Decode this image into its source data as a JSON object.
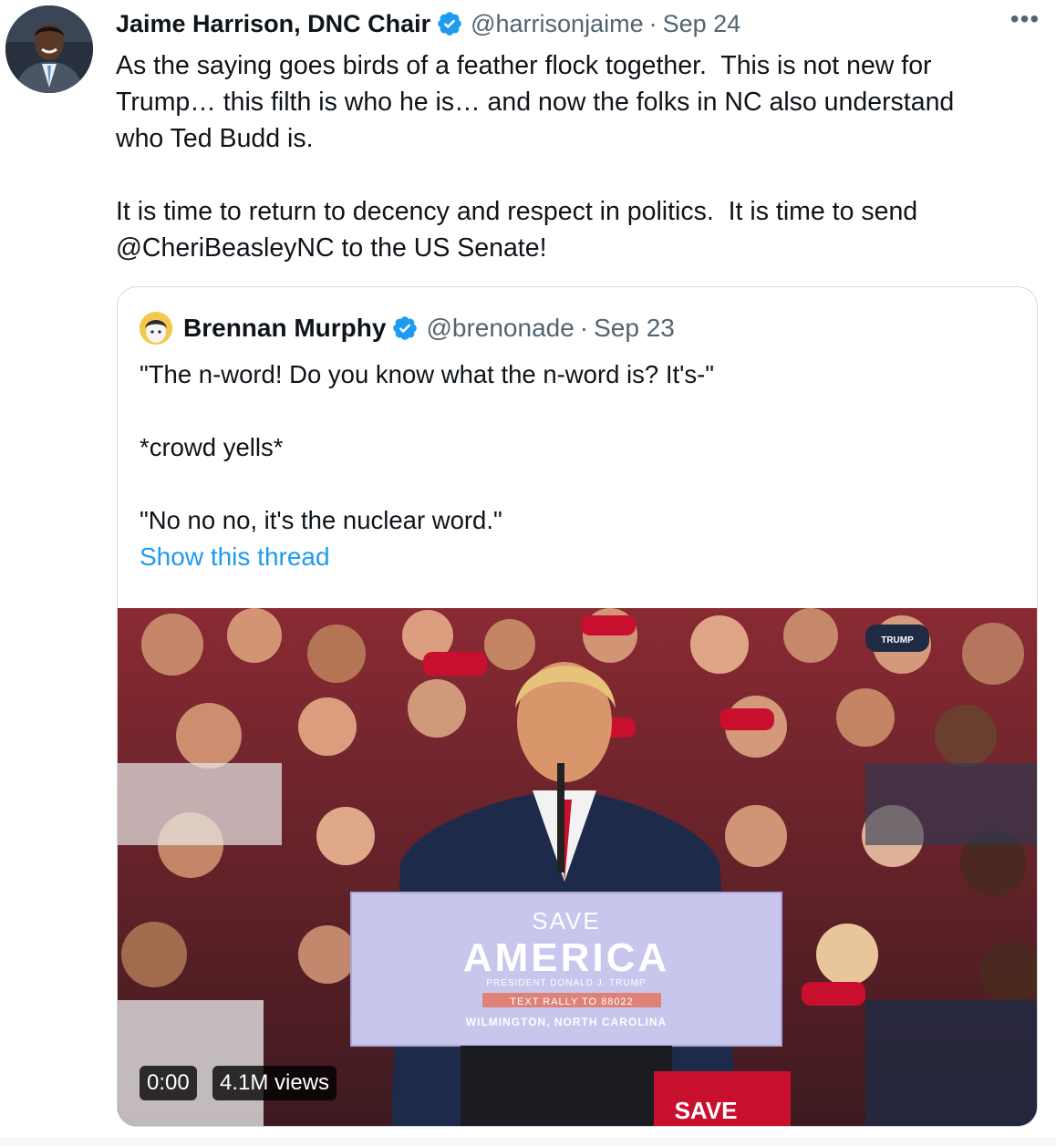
{
  "tweet": {
    "author_name": "Jaime Harrison, DNC Chair",
    "handle": "@harrisonjaime",
    "separator": "·",
    "date": "Sep 24",
    "more_label": "•••",
    "text": "As the saying goes birds of a feather flock together.  This is not new for\nTrump… this filth is who he is… and now the folks in NC also understand\nwho Ted Budd is.\n\nIt is time to return to decency and respect in politics.  It is time to send\n@CheriBeasleyNC to the US Senate!"
  },
  "quoted_tweet": {
    "author_name": "Brennan Murphy",
    "handle": "@brenonade",
    "separator": "·",
    "date": "Sep 23",
    "text": "\"The n-word! Do you know what the n-word is? It's-\"\n\n*crowd yells*\n\n\"No no no, it's the nuclear word.\"",
    "show_thread_label": "Show this thread",
    "video": {
      "time": "0:00",
      "views": "4.1M views",
      "podium_line1": "SAVE",
      "podium_line2": "AMERICA",
      "podium_line3": "PRESIDENT DONALD J. TRUMP",
      "podium_line4": "TEXT RALLY TO 88022",
      "podium_line5": "WILMINGTON, NORTH CAROLINA",
      "sign_text": "SAVE",
      "hat_text": "TRUMP"
    }
  },
  "colors": {
    "link": "#1d9bf0",
    "verified": "#1d9bf0",
    "secondary_text": "#536471",
    "border": "#cfd9de"
  },
  "icons": {
    "verified": "verified-badge-icon",
    "more": "more-options-icon"
  }
}
